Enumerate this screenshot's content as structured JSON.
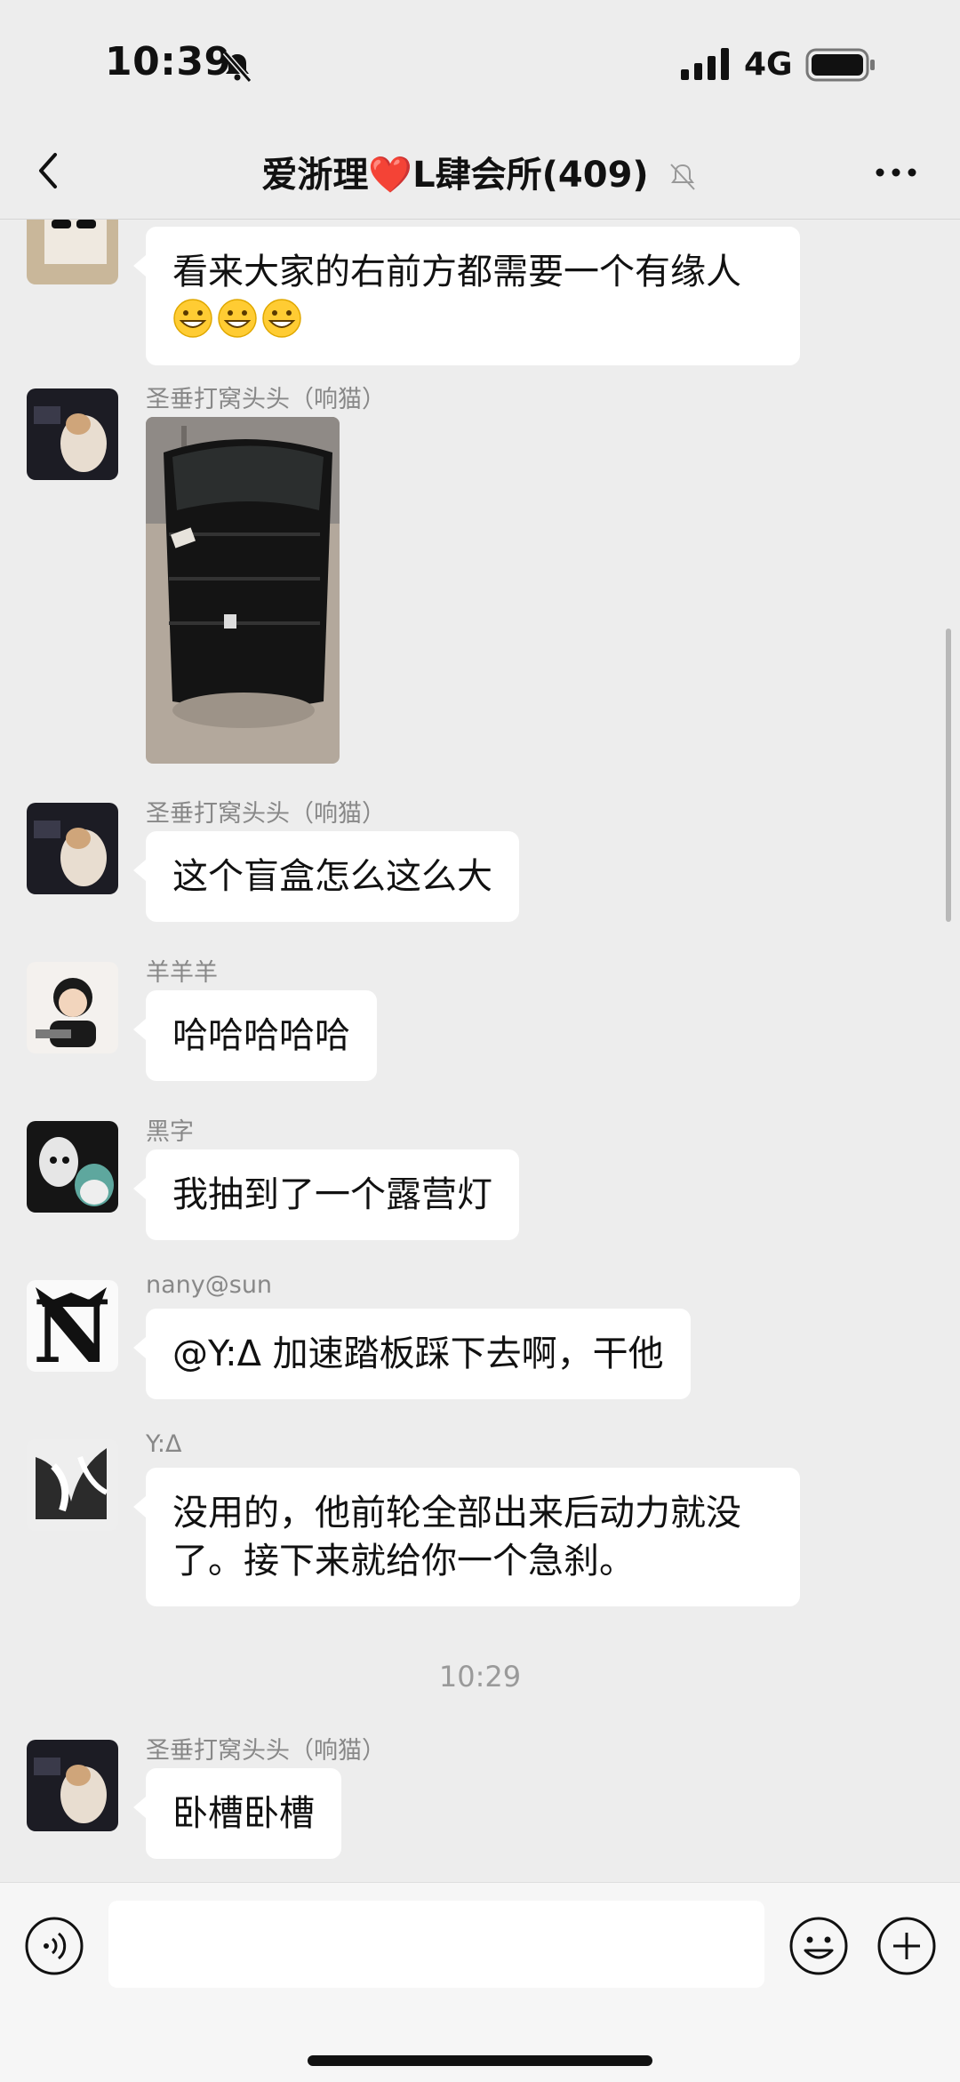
{
  "status_bar": {
    "time": "10:39",
    "network": "4G"
  },
  "header": {
    "title": "爱浙理❤️L肆会所(409)"
  },
  "messages": [
    {
      "sender": "",
      "text": "看来大家的右前方都需要一个有缘人",
      "emojis": [
        "grinning-face",
        "grinning-face",
        "grinning-face"
      ]
    },
    {
      "sender": "圣垂打窝头头（响猫）",
      "type": "image",
      "image": "black suitcase wrapped in plastic"
    },
    {
      "sender": "圣垂打窝头头（响猫）",
      "text": "这个盲盒怎么这么大"
    },
    {
      "sender": "羊羊羊",
      "text": "哈哈哈哈哈"
    },
    {
      "sender": "黑字",
      "text": "我抽到了一个露营灯"
    },
    {
      "sender": "nany@sun",
      "text": "@Y:Δ 加速踏板踩下去啊，干他"
    },
    {
      "sender": "Y:Δ",
      "text": "没用的，他前轮全部出来后动力就没了。接下来就给你一个急刹。"
    },
    {
      "sender": "圣垂打窝头头（响猫）",
      "text": "卧槽卧槽"
    }
  ],
  "timestamp": "10:29",
  "input_bar": {
    "value": "",
    "placeholder": ""
  },
  "icons": [
    "back-icon",
    "more-icon",
    "voice-icon",
    "emoji-icon",
    "plus-icon",
    "bell-off-icon"
  ]
}
